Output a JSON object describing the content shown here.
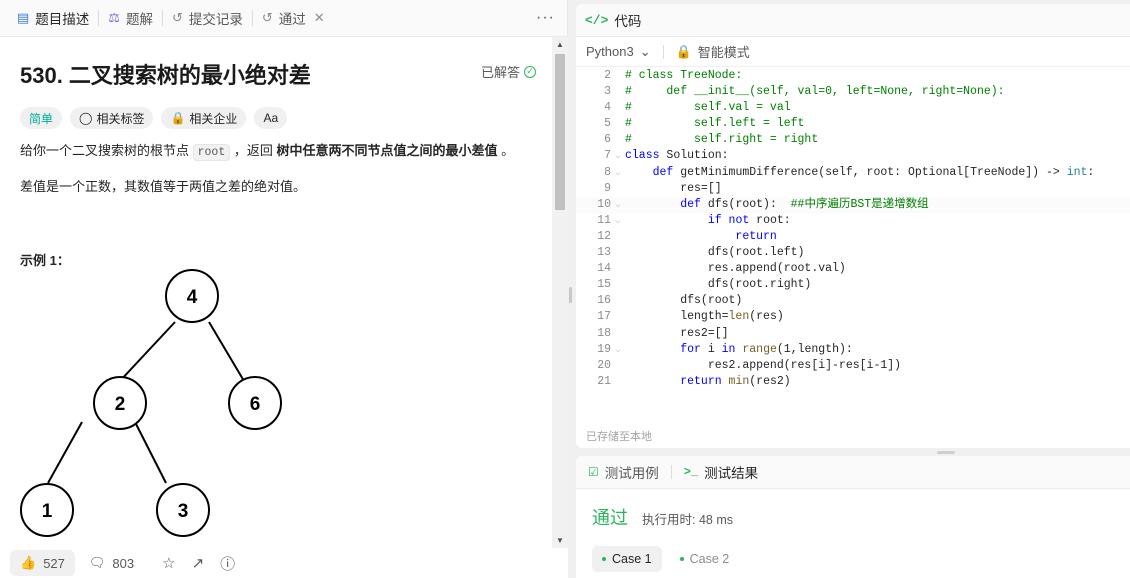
{
  "left_panel": {
    "tabs": [
      {
        "label": "题目描述",
        "icon": "document-icon"
      },
      {
        "label": "题解",
        "icon": "flask-icon"
      },
      {
        "label": "提交记录",
        "icon": "history-icon"
      },
      {
        "label": "通过",
        "icon": "history-icon"
      }
    ],
    "more": "···",
    "problem": {
      "title": "530. 二叉搜索树的最小绝对差",
      "status": "已解答",
      "tags": [
        "简单",
        "相关标签",
        "相关企业",
        "Aa"
      ],
      "desc_prefix": "给你一个二叉搜索树的根节点 ",
      "desc_code": "root",
      "desc_mid": " ，返回 ",
      "desc_bold": "树中任意两不同节点值之间的最小差值",
      "desc_suffix": " 。",
      "desc2": "差值是一个正数，其数值等于两值之差的绝对值。",
      "example_label": "示例 1：",
      "tree_nodes": [
        "4",
        "2",
        "6",
        "1",
        "3"
      ]
    },
    "bottom": {
      "likes": "527",
      "comments": "803"
    }
  },
  "code_panel": {
    "title": "代码",
    "language": "Python3",
    "mode": "智能模式",
    "saved_text": "已存储至本地",
    "lines": [
      {
        "n": "2",
        "text": "# class TreeNode:"
      },
      {
        "n": "3",
        "text": "#     def __init__(self, val=0, left=None, right=None):"
      },
      {
        "n": "4",
        "text": "#         self.val = val"
      },
      {
        "n": "5",
        "text": "#         self.left = left"
      },
      {
        "n": "6",
        "text": "#         self.right = right"
      },
      {
        "n": "7",
        "text": "class Solution:"
      },
      {
        "n": "8",
        "text": "    def getMinimumDifference(self, root: Optional[TreeNode]) -> int:"
      },
      {
        "n": "9",
        "text": "        res=[]"
      },
      {
        "n": "10",
        "text": "        def dfs(root):  ##中序遍历BST是递增数组"
      },
      {
        "n": "11",
        "text": "            if not root:"
      },
      {
        "n": "12",
        "text": "                return"
      },
      {
        "n": "13",
        "text": "            dfs(root.left)"
      },
      {
        "n": "14",
        "text": "            res.append(root.val)"
      },
      {
        "n": "15",
        "text": "            dfs(root.right)"
      },
      {
        "n": "16",
        "text": "        dfs(root)"
      },
      {
        "n": "17",
        "text": "        length=len(res)"
      },
      {
        "n": "18",
        "text": "        res2=[]"
      },
      {
        "n": "19",
        "text": "        for i in range(1,length):"
      },
      {
        "n": "20",
        "text": "            res2.append(res[i]-res[i-1])"
      },
      {
        "n": "21",
        "text": "        return min(res2)"
      }
    ]
  },
  "result_panel": {
    "tab_testcase": "测试用例",
    "tab_result": "测试结果",
    "status": "通过",
    "runtime": "执行用时: 48 ms",
    "cases": [
      "Case 1",
      "Case 2"
    ]
  }
}
